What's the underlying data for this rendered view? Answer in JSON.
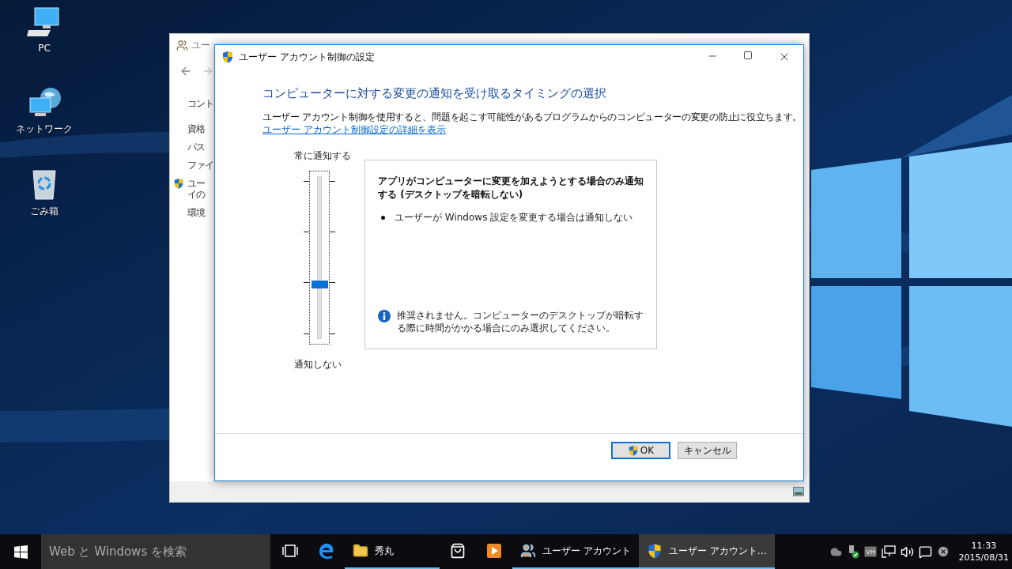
{
  "desktop_icons": [
    {
      "label": "PC",
      "kind": "pc"
    },
    {
      "label": "ネットワーク",
      "kind": "network"
    },
    {
      "label": "ごみ箱",
      "kind": "recycle"
    }
  ],
  "background_window": {
    "title": "ユー",
    "sidebar_items": [
      {
        "text": "コント",
        "shield": false
      },
      {
        "text": "資格",
        "shield": false
      },
      {
        "text": "パス",
        "shield": false
      },
      {
        "text": "ファイ",
        "shield": false
      },
      {
        "text": "ユー",
        "shield": true
      },
      {
        "text": "イの",
        "shield": false
      },
      {
        "text": "環境",
        "shield": false
      }
    ]
  },
  "dialog": {
    "title": "ユーザー アカウント制御の設定",
    "heading": "コンピューターに対する変更の通知を受け取るタイミングの選択",
    "description": "ユーザー アカウント制御を使用すると、問題を起こす可能性があるプログラムからのコンピューターの変更の防止に役立ちます。",
    "link": "ユーザー アカウント制御設定の詳細を表示",
    "slider": {
      "top_label": "常に通知する",
      "bottom_label": "通知しない",
      "level": 0.33
    },
    "info_panel": {
      "title": "アプリがコンピューターに変更を加えようとする場合のみ通知する (デスクトップを暗転しない)",
      "bullets": [
        "ユーザーが Windows 設定を変更する場合は通知しない"
      ],
      "note": "推奨されません。コンピューターのデスクトップが暗転する際に時間がかかる場合にのみ選択してください。"
    },
    "buttons": [
      {
        "label": "OK",
        "shield": true,
        "default": true
      },
      {
        "label": "キャンセル",
        "shield": false,
        "default": false
      }
    ]
  },
  "taskbar": {
    "search": {
      "placeholder": "Web と Windows を検索"
    },
    "apps": [
      {
        "kind": "task-view",
        "running": false,
        "selected": false
      },
      {
        "kind": "edge",
        "running": false,
        "selected": false
      },
      {
        "kind": "folder",
        "label": "秀丸",
        "running": true,
        "selected": false
      },
      {
        "kind": "store",
        "running": false,
        "selected": false
      },
      {
        "kind": "media",
        "running": false,
        "selected": false
      },
      {
        "kind": "users",
        "label": "ユーザー アカウント",
        "running": true,
        "selected": false
      },
      {
        "kind": "shield",
        "label": "ユーザー アカウント…",
        "running": true,
        "selected": true
      }
    ],
    "tray": [
      {
        "kind": "cloud"
      },
      {
        "kind": "usb"
      },
      {
        "kind": "vm"
      },
      {
        "kind": "network"
      },
      {
        "kind": "volume"
      },
      {
        "kind": "notifications"
      },
      {
        "kind": "close"
      }
    ],
    "clock": {
      "time": "11:33",
      "date": "2015/08/31"
    }
  }
}
